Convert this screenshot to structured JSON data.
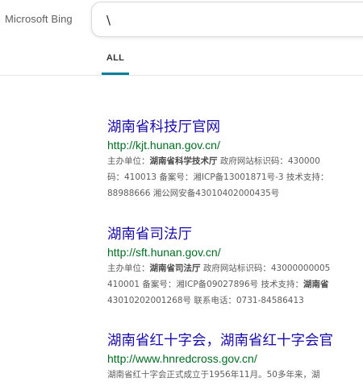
{
  "brand": "Microsoft Bing",
  "search": {
    "query": "\\"
  },
  "tabs": [
    {
      "label": "ALL",
      "active": true
    }
  ],
  "colors": {
    "accent": "#00809d",
    "title_link": "#1a0dab",
    "url": "#006d21"
  },
  "results": [
    {
      "title": "湖南省科技厅官网",
      "url": "http://kjt.hunan.gov.cn/",
      "snippet": {
        "l1_prefix": "主办单位：",
        "l1_bold": "湖南省科学技术厅",
        "l1_suffix": " 政府网站标识码：430000",
        "l2": "码：410013 备案号：湘ICP备13001871号-3 技术支持：",
        "l3": "88988666 湘公网安备43010402000435号"
      }
    },
    {
      "title": "湖南省司法厅",
      "url": "http://sft.hunan.gov.cn/",
      "snippet": {
        "l1_prefix": "主办单位：",
        "l1_bold": "湖南省司法厅",
        "l1_suffix": " 政府网站标识码：43000000005",
        "l2_prefix": "410001 备案号：湘ICP备09027896号 技术支持：",
        "l2_bold": "湖南省",
        "l3": "43010202001268号 联系电话：0731-84586413"
      }
    },
    {
      "title": "湖南省红十字会，湖南省红十字会官",
      "url": "http://www.hnredcross.gov.cn/",
      "snippet": {
        "l1": "湖南省红十字会正式成立于1956年11月。50多年来，湖"
      }
    }
  ]
}
